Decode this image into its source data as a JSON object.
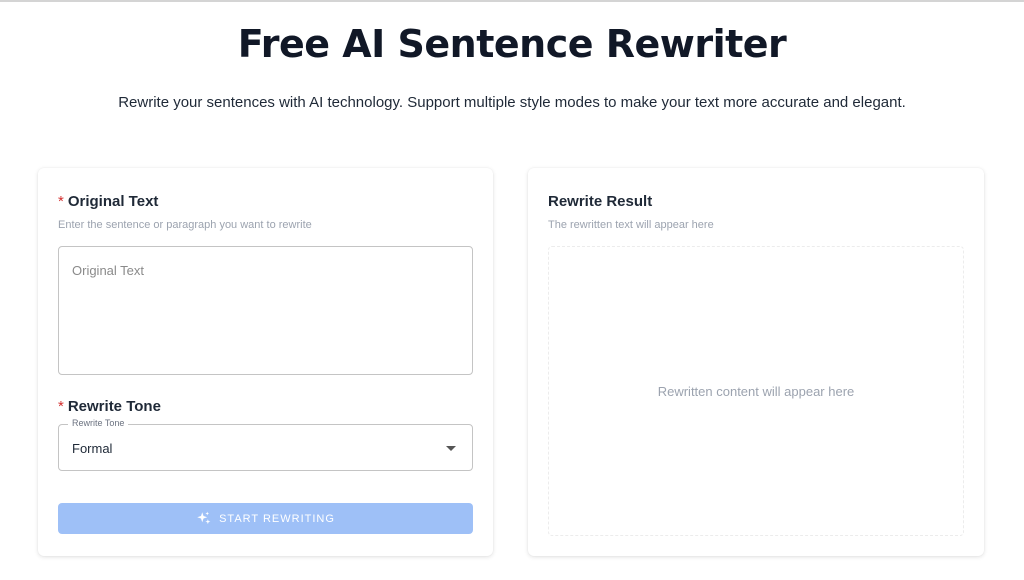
{
  "header": {
    "title": "Free AI Sentence Rewriter",
    "subtitle": "Rewrite your sentences with AI technology. Support multiple style modes to make your text more accurate and elegant."
  },
  "input_card": {
    "original": {
      "required_mark": "*",
      "label": "Original Text",
      "hint": "Enter the sentence or paragraph you want to rewrite",
      "placeholder": "Original Text",
      "value": ""
    },
    "tone": {
      "required_mark": "*",
      "label": "Rewrite Tone",
      "field_label": "Rewrite Tone",
      "selected": "Formal"
    },
    "button": {
      "label": "START REWRITING",
      "icon": "sparkle-icon",
      "disabled": true
    }
  },
  "result_card": {
    "label": "Rewrite Result",
    "hint": "The rewritten text will appear here",
    "placeholder": "Rewritten content will appear here"
  },
  "colors": {
    "required": "#d32f2f",
    "button_disabled_bg": "#9ec0f7",
    "title": "#111827"
  }
}
